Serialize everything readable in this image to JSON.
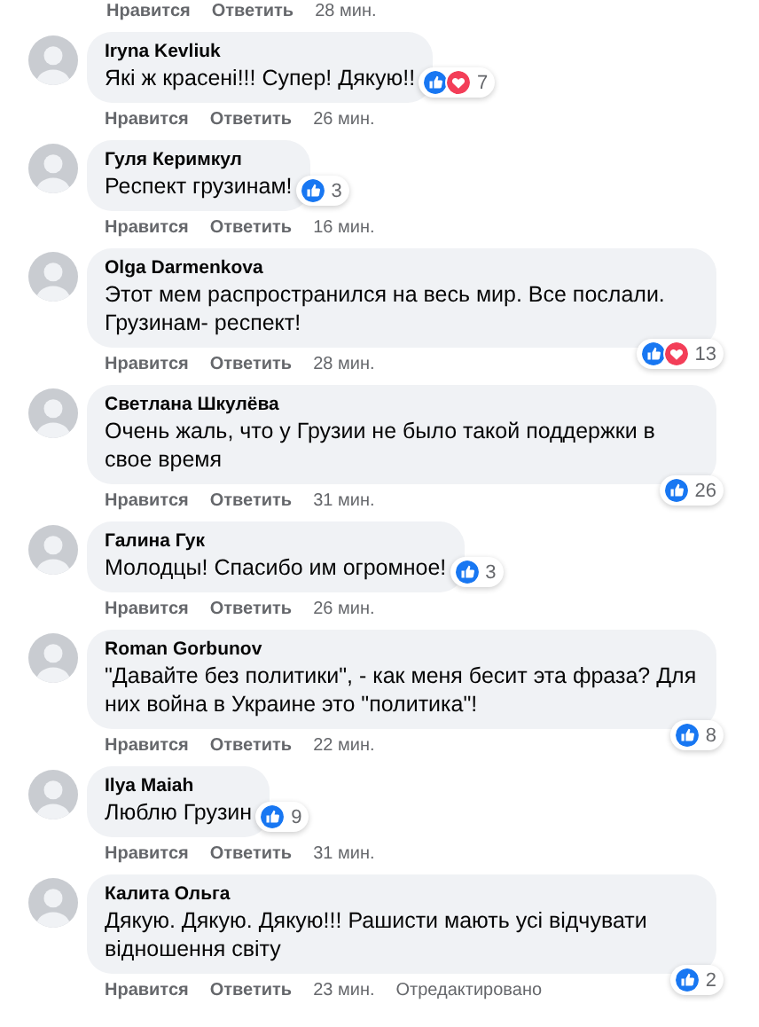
{
  "top_actions": {
    "like": "Нравится",
    "reply": "Ответить",
    "time": "28 мин."
  },
  "comments": [
    {
      "author": "Iryna Kevliuk",
      "text": "Які ж красені!!! Супер! Дякую!!",
      "reactions": [
        {
          "kind": "like"
        },
        {
          "kind": "love"
        }
      ],
      "count": "7",
      "like": "Нравится",
      "reply": "Ответить",
      "time": "26 мин."
    },
    {
      "author": "Гуля Керимкул",
      "text": "Респект грузинам!",
      "reactions": [
        {
          "kind": "like"
        }
      ],
      "count": "3",
      "like": "Нравится",
      "reply": "Ответить",
      "time": "16 мин."
    },
    {
      "author": "Olga Darmenkova",
      "text": "Этот мем распространился на весь мир. Все послали. Грузинам- респект!",
      "reactions": [
        {
          "kind": "like"
        },
        {
          "kind": "love"
        }
      ],
      "count": "13",
      "like": "Нравится",
      "reply": "Ответить",
      "time": "28 мин."
    },
    {
      "author": "Светлана Шкулёва",
      "text": "Очень жаль, что у Грузии не было такой поддержки в свое время",
      "reactions": [
        {
          "kind": "like"
        }
      ],
      "count": "26",
      "like": "Нравится",
      "reply": "Ответить",
      "time": "31 мин."
    },
    {
      "author": "Галина Гук",
      "text": "Молодцы! Спасибо им огромное!",
      "reactions": [
        {
          "kind": "like"
        }
      ],
      "count": "3",
      "like": "Нравится",
      "reply": "Ответить",
      "time": "26 мин."
    },
    {
      "author": "Roman Gorbunov",
      "text": "\"Давайте без политики\", - как меня бесит эта фраза? Для них война в Украине это \"политика\"!",
      "reactions": [
        {
          "kind": "like"
        }
      ],
      "count": "8",
      "like": "Нравится",
      "reply": "Ответить",
      "time": "22 мин."
    },
    {
      "author": "Ilya Maiah",
      "text": "Люблю Грузин",
      "reactions": [
        {
          "kind": "like"
        }
      ],
      "count": "9",
      "like": "Нравится",
      "reply": "Ответить",
      "time": "31 мин."
    },
    {
      "author": "Калита Ольга",
      "text": "Дякую. Дякую. Дякую!!! Рашисти мають усі відчувати відношення світу",
      "reactions": [
        {
          "kind": "like"
        }
      ],
      "count": "2",
      "like": "Нравится",
      "reply": "Ответить",
      "time": "23 мин.",
      "edited": "Отредактировано"
    }
  ]
}
